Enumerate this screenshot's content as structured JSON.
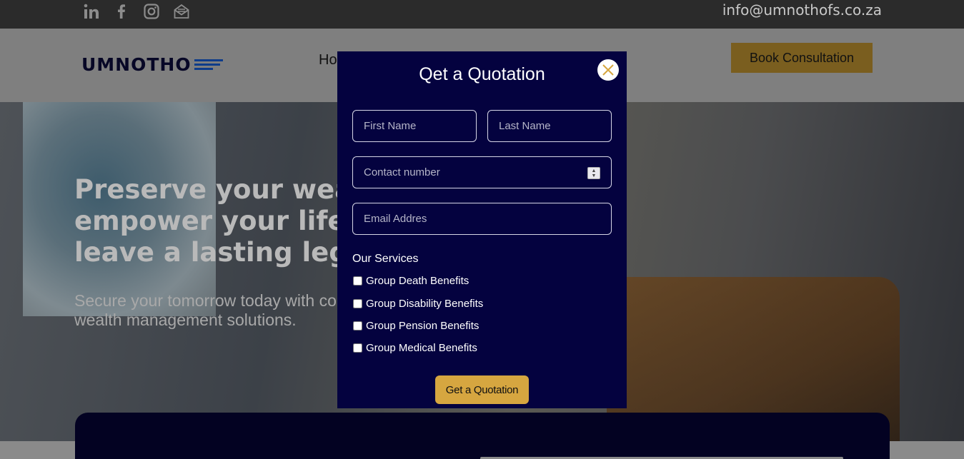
{
  "topbar": {
    "social_icons": [
      "linkedin-icon",
      "facebook-icon",
      "instagram-icon",
      "mail-icon"
    ],
    "email": "info@umnothofs.co.za"
  },
  "nav": {
    "logo_text": "UMNOTHO",
    "home_label": "Ho",
    "book_button": "Book Consultation"
  },
  "hero": {
    "title_lines": [
      "Preserve your weal",
      "empower your life,",
      "leave a lasting lega"
    ],
    "subtitle_lines": [
      "Secure your tomorrow today with co",
      "wealth management solutions."
    ]
  },
  "modal": {
    "title": "Qet a Quotation",
    "first_name_placeholder": "First Name",
    "last_name_placeholder": "Last Name",
    "contact_placeholder": "Contact number",
    "email_placeholder": "Email Addres",
    "services_label": "Our Services",
    "services": [
      "Group Death Benefits",
      "Group Disability Benefits",
      "Group Pension Benefits",
      "Group Medical Benefits"
    ],
    "submit_label": "Get a Quotation"
  },
  "colors": {
    "modal_bg": "#04023f",
    "accent_gold": "#d6a640",
    "logo_blue": "#0e3c8a"
  }
}
